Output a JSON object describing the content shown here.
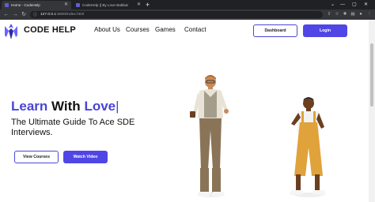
{
  "browser": {
    "tabs": [
      {
        "title": "Home - CodeHelp",
        "active": true
      },
      {
        "title": "CodeHelp || By Love Babbar",
        "active": false
      }
    ],
    "url_host": "127.0.0.1",
    "url_path": ":5500/index.html"
  },
  "site": {
    "brand": "CODE HELP",
    "nav": [
      "About Us",
      "Courses",
      "Games",
      "Contact"
    ],
    "dashboard_label": "Dashboard",
    "login_label": "Login"
  },
  "hero": {
    "title_part1": "Learn",
    "title_part2": "With",
    "title_part3": "Love",
    "caret": "|",
    "subtitle": "The Ultimate Guide To Ace SDE Interviews.",
    "btn_courses": "View Courses",
    "btn_video": "Watch Video"
  },
  "colors": {
    "accent": "#4f46e5",
    "tab_strip": "#202124",
    "toolbar": "#35363a"
  }
}
